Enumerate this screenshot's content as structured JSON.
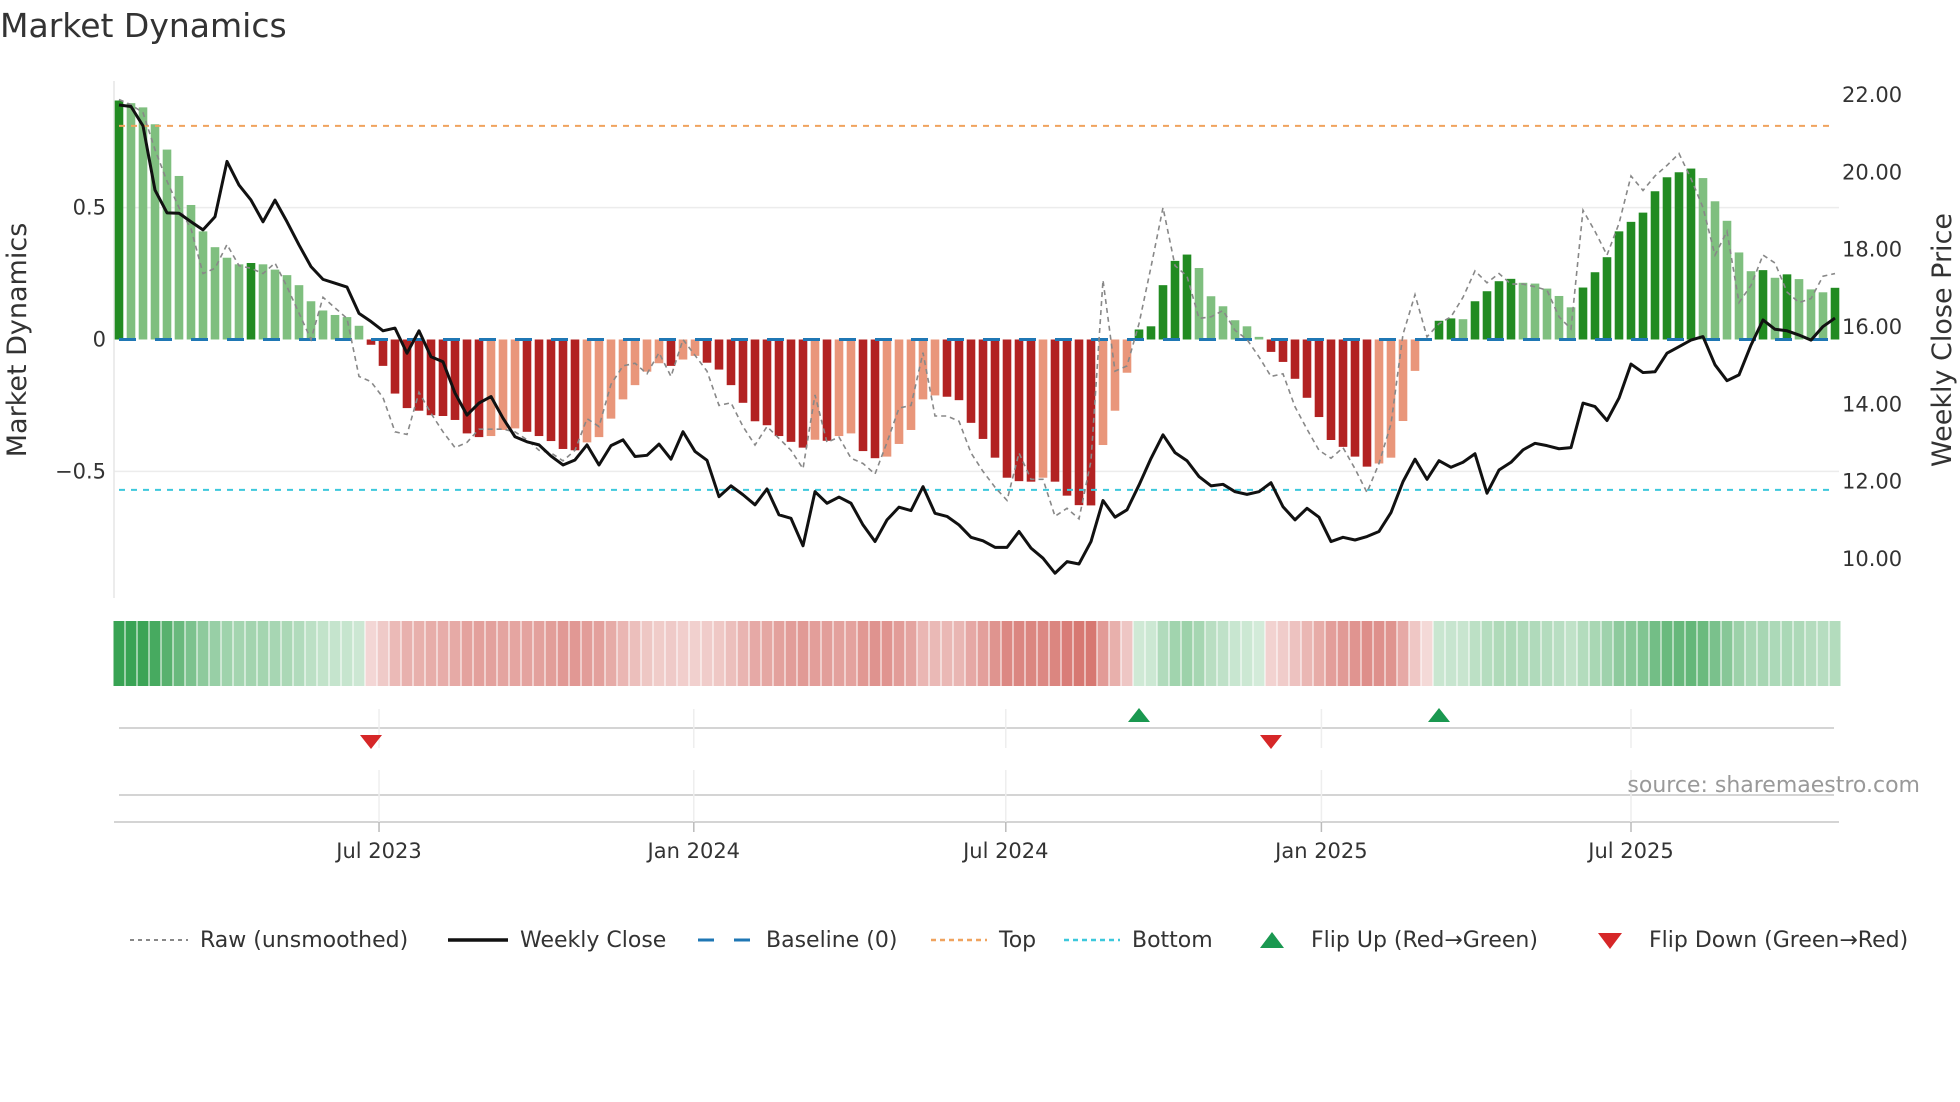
{
  "title": "Market Dynamics",
  "source": "source: sharemaestro.com",
  "colors": {
    "green_strong": "#228b22",
    "green_weak": "#7fbf7f",
    "red_strong": "#b22222",
    "red_weak": "#e9967a",
    "heat_green": "#2e9e4a",
    "heat_red": "#c8443c",
    "raw": "#888888",
    "close": "#111111",
    "baseline": "#1f77b4",
    "top": "#f0a35e",
    "bottom": "#3cc8dc",
    "flip_up": "#1a9850",
    "flip_down": "#d62728"
  },
  "legend": [
    {
      "label": "Raw (unsmoothed)",
      "icon": "dotted-gray-line"
    },
    {
      "label": "Weekly Close",
      "icon": "solid-black-line"
    },
    {
      "label": "Baseline (0)",
      "icon": "dashed-blue-line"
    },
    {
      "label": "Top",
      "icon": "dotted-orange-line"
    },
    {
      "label": "Bottom",
      "icon": "dotted-cyan-line"
    },
    {
      "label": "Flip Up (Red→Green)",
      "icon": "triangle-up-green"
    },
    {
      "label": "Flip Down (Green→Red)",
      "icon": "triangle-down-red"
    }
  ],
  "chart_data": {
    "type": "bar",
    "title": "Market Dynamics",
    "ylabel": "Market Dynamics",
    "y2label": "Weekly Close Price",
    "ylim": [
      -0.98,
      0.98
    ],
    "y2lim": [
      8.99,
      22.36
    ],
    "yticks": [
      {
        "v": 0.5,
        "label": "0.5"
      },
      {
        "v": 0,
        "label": "0"
      },
      {
        "v": -0.5,
        "label": "−0.5"
      }
    ],
    "y2ticks": [
      {
        "v": 22,
        "label": "22.00"
      },
      {
        "v": 20,
        "label": "20.00"
      },
      {
        "v": 18,
        "label": "18.00"
      },
      {
        "v": 16,
        "label": "16.00"
      },
      {
        "v": 14,
        "label": "14.00"
      },
      {
        "v": 12,
        "label": "12.00"
      },
      {
        "v": 10,
        "label": "10.00"
      }
    ],
    "xticks": [
      {
        "pos": 21.67,
        "label": "Jul 2023"
      },
      {
        "pos": 47.9,
        "label": "Jan 2024"
      },
      {
        "pos": 73.9,
        "label": "Jul 2024"
      },
      {
        "pos": 100.2,
        "label": "Jan 2025"
      },
      {
        "pos": 126.0,
        "label": "Jul 2025"
      }
    ],
    "top_level": 0.81,
    "bottom_level": -0.57,
    "baseline": 0,
    "flip_up_index": [
      85,
      110
    ],
    "flip_down_index": [
      21,
      96
    ],
    "values": [
      0.906,
      0.896,
      0.88,
      0.816,
      0.72,
      0.62,
      0.51,
      0.41,
      0.35,
      0.31,
      0.285,
      0.29,
      0.285,
      0.265,
      0.244,
      0.206,
      0.145,
      0.11,
      0.093,
      0.085,
      0.052,
      -0.02,
      -0.1,
      -0.205,
      -0.26,
      -0.27,
      -0.287,
      -0.29,
      -0.305,
      -0.356,
      -0.37,
      -0.366,
      -0.343,
      -0.337,
      -0.35,
      -0.366,
      -0.385,
      -0.415,
      -0.42,
      -0.39,
      -0.37,
      -0.3,
      -0.227,
      -0.173,
      -0.122,
      -0.09,
      -0.1,
      -0.076,
      -0.062,
      -0.088,
      -0.114,
      -0.173,
      -0.24,
      -0.31,
      -0.325,
      -0.366,
      -0.388,
      -0.41,
      -0.38,
      -0.384,
      -0.366,
      -0.356,
      -0.423,
      -0.45,
      -0.444,
      -0.396,
      -0.343,
      -0.227,
      -0.212,
      -0.217,
      -0.23,
      -0.316,
      -0.377,
      -0.448,
      -0.524,
      -0.537,
      -0.539,
      -0.524,
      -0.539,
      -0.592,
      -0.628,
      -0.629,
      -0.4,
      -0.27,
      -0.126,
      0.038,
      0.05,
      0.206,
      0.298,
      0.322,
      0.271,
      0.164,
      0.126,
      0.073,
      0.05,
      0.01,
      -0.047,
      -0.085,
      -0.149,
      -0.221,
      -0.294,
      -0.381,
      -0.407,
      -0.444,
      -0.482,
      -0.47,
      -0.448,
      -0.309,
      -0.119,
      -0.005,
      0.071,
      0.08,
      0.077,
      0.145,
      0.183,
      0.221,
      0.23,
      0.215,
      0.212,
      0.193,
      0.165,
      0.122,
      0.197,
      0.255,
      0.312,
      0.41,
      0.446,
      0.481,
      0.562,
      0.615,
      0.634,
      0.648,
      0.612,
      0.524,
      0.45,
      0.33,
      0.259,
      0.263,
      0.234,
      0.247,
      0.229,
      0.19,
      0.179,
      0.196
    ],
    "raw": [
      0.91,
      0.89,
      0.86,
      0.72,
      0.6,
      0.5,
      0.42,
      0.25,
      0.27,
      0.36,
      0.28,
      0.27,
      0.25,
      0.29,
      0.2,
      0.1,
      0.0,
      0.16,
      0.12,
      0.08,
      -0.14,
      -0.16,
      -0.22,
      -0.35,
      -0.36,
      -0.2,
      -0.28,
      -0.35,
      -0.41,
      -0.39,
      -0.34,
      -0.34,
      -0.34,
      -0.35,
      -0.38,
      -0.42,
      -0.43,
      -0.46,
      -0.42,
      -0.3,
      -0.33,
      -0.17,
      -0.1,
      -0.09,
      -0.13,
      -0.05,
      -0.14,
      0.0,
      -0.06,
      -0.12,
      -0.25,
      -0.24,
      -0.33,
      -0.4,
      -0.33,
      -0.375,
      -0.42,
      -0.49,
      -0.21,
      -0.39,
      -0.37,
      -0.45,
      -0.47,
      -0.51,
      -0.39,
      -0.26,
      -0.25,
      -0.05,
      -0.29,
      -0.29,
      -0.31,
      -0.43,
      -0.5,
      -0.56,
      -0.61,
      -0.43,
      -0.53,
      -0.53,
      -0.67,
      -0.64,
      -0.68,
      -0.46,
      0.225,
      -0.12,
      -0.1,
      0.06,
      0.275,
      0.5,
      0.28,
      0.24,
      0.08,
      0.086,
      0.11,
      0.035,
      0.0,
      -0.066,
      -0.14,
      -0.13,
      -0.255,
      -0.34,
      -0.42,
      -0.45,
      -0.41,
      -0.49,
      -0.58,
      -0.47,
      -0.32,
      0.02,
      0.17,
      0.01,
      0.06,
      0.086,
      0.16,
      0.26,
      0.215,
      0.25,
      0.21,
      0.21,
      0.2,
      0.187,
      0.086,
      0.04,
      0.49,
      0.41,
      0.32,
      0.44,
      0.62,
      0.565,
      0.62,
      0.66,
      0.705,
      0.61,
      0.5,
      0.32,
      0.41,
      0.14,
      0.205,
      0.32,
      0.29,
      0.18,
      0.14,
      0.155,
      0.24,
      0.25
    ],
    "close": [
      21.74,
      21.7,
      21.2,
      19.54,
      18.95,
      18.94,
      18.72,
      18.51,
      18.85,
      20.28,
      19.67,
      19.28,
      18.72,
      19.28,
      18.72,
      18.12,
      17.56,
      17.23,
      17.13,
      17.03,
      16.35,
      16.14,
      15.9,
      15.97,
      15.32,
      15.9,
      15.23,
      15.1,
      14.29,
      13.72,
      14.03,
      14.2,
      13.64,
      13.16,
      13.03,
      12.95,
      12.66,
      12.43,
      12.56,
      12.95,
      12.43,
      12.93,
      13.08,
      12.65,
      12.68,
      12.97,
      12.58,
      13.29,
      12.78,
      12.55,
      11.61,
      11.89,
      11.66,
      11.4,
      11.81,
      11.14,
      11.05,
      10.34,
      11.74,
      11.44,
      11.6,
      11.44,
      10.88,
      10.45,
      11.01,
      11.34,
      11.25,
      11.87,
      11.18,
      11.1,
      10.88,
      10.56,
      10.47,
      10.3,
      10.3,
      10.71,
      10.28,
      10.02,
      9.63,
      9.93,
      9.87,
      10.45,
      11.51,
      11.08,
      11.27,
      11.91,
      12.6,
      13.21,
      12.75,
      12.54,
      12.13,
      11.89,
      11.93,
      11.74,
      11.67,
      11.74,
      11.97,
      11.35,
      11.01,
      11.31,
      11.08,
      10.45,
      10.56,
      10.49,
      10.58,
      10.71,
      11.2,
      12.0,
      12.58,
      12.06,
      12.54,
      12.37,
      12.5,
      12.72,
      11.7,
      12.3,
      12.5,
      12.82,
      12.99,
      12.93,
      12.85,
      12.88,
      14.03,
      13.94,
      13.58,
      14.16,
      15.04,
      14.82,
      14.84,
      15.32,
      15.49,
      15.66,
      15.75,
      15.02,
      14.61,
      14.76,
      15.53,
      16.18,
      15.94,
      15.9,
      15.79,
      15.66,
      16.01,
      16.23
    ]
  }
}
